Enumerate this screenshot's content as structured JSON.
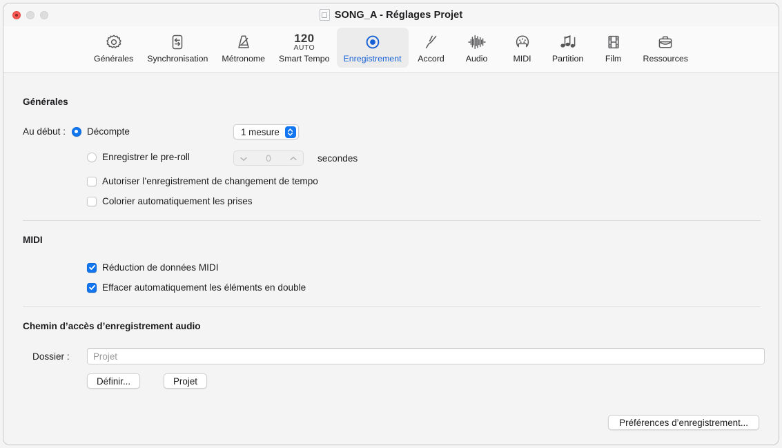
{
  "window": {
    "title": "SONG_A - Réglages Projet",
    "traffic_lights": [
      "close",
      "minimize",
      "maximize"
    ]
  },
  "toolbar": {
    "tabs": [
      {
        "label": "Générales",
        "icon": "gear-icon",
        "selected": false
      },
      {
        "label": "Synchronisation",
        "icon": "sync-icon",
        "selected": false
      },
      {
        "label": "Métronome",
        "icon": "metronome-icon",
        "selected": false
      },
      {
        "label": "Smart Tempo",
        "icon": "tempo-icon",
        "selected": false,
        "tempo_value": "120",
        "tempo_mode": "AUTO"
      },
      {
        "label": "Enregistrement",
        "icon": "record-icon",
        "selected": true
      },
      {
        "label": "Accord",
        "icon": "tuning-fork-icon",
        "selected": false
      },
      {
        "label": "Audio",
        "icon": "waveform-icon",
        "selected": false
      },
      {
        "label": "MIDI",
        "icon": "midi-port-icon",
        "selected": false
      },
      {
        "label": "Partition",
        "icon": "music-notes-icon",
        "selected": false
      },
      {
        "label": "Film",
        "icon": "film-strip-icon",
        "selected": false
      },
      {
        "label": "Ressources",
        "icon": "briefcase-icon",
        "selected": false
      }
    ]
  },
  "sections": {
    "generales": {
      "heading": "Générales",
      "au_debut_label": "Au début :",
      "decompte": {
        "label": "Décompte",
        "selected": true,
        "popup_value": "1 mesure"
      },
      "preroll": {
        "label": "Enregistrer le pre-roll",
        "selected": false,
        "value": "0",
        "unit": "secondes",
        "disabled": true
      },
      "checkboxes": [
        {
          "label": "Autoriser l’enregistrement de changement de tempo",
          "checked": false
        },
        {
          "label": "Colorier automatiquement les prises",
          "checked": false
        }
      ]
    },
    "midi": {
      "heading": "MIDI",
      "checkboxes": [
        {
          "label": "Réduction de données MIDI",
          "checked": true
        },
        {
          "label": "Effacer automatiquement les éléments en double",
          "checked": true
        }
      ]
    },
    "chemin": {
      "heading": "Chemin d’accès d’enregistrement audio",
      "folder_label": "Dossier :",
      "folder_value": "Projet",
      "buttons": [
        {
          "label": "Définir..."
        },
        {
          "label": "Projet"
        }
      ]
    }
  },
  "footer": {
    "preferences_button": "Préférences d’enregistrement..."
  },
  "colors": {
    "accent_blue": "#1176ef",
    "selected_tab_text": "#1761d6",
    "close_red": "#fc5b57",
    "content_bg": "#f4f4f4",
    "toolbar_bg": "#fafafa"
  }
}
